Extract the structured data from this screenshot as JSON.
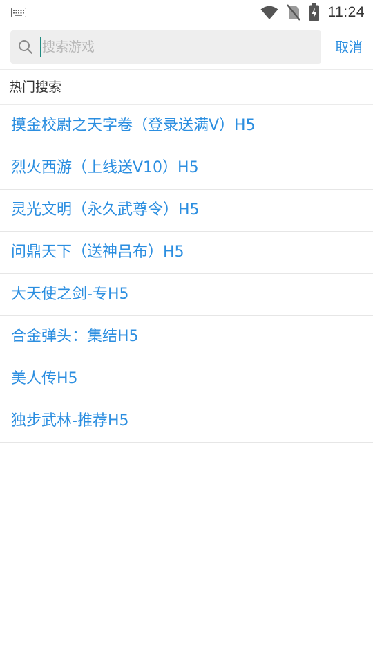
{
  "status_bar": {
    "time": "11:24",
    "icons": [
      "keyboard-icon",
      "wifi-icon",
      "no-sim-icon",
      "battery-charging-icon"
    ]
  },
  "search": {
    "placeholder": "搜索游戏",
    "value": "",
    "cancel_label": "取消"
  },
  "hot": {
    "title": "热门搜索",
    "items": [
      {
        "label": "摸金校尉之天字卷（登录送满V）H5"
      },
      {
        "label": "烈火西游（上线送V10）H5"
      },
      {
        "label": "灵光文明（永久武尊令）H5"
      },
      {
        "label": "问鼎天下（送神吕布）H5"
      },
      {
        "label": "大天使之剑-专H5"
      },
      {
        "label": "合金弹头：集结H5"
      },
      {
        "label": "美人传H5"
      },
      {
        "label": "独步武林-推荐H5"
      }
    ]
  },
  "colors": {
    "accent": "#2b8ee0",
    "search_bg": "#eeeeee",
    "divider": "#e6e6e6"
  }
}
